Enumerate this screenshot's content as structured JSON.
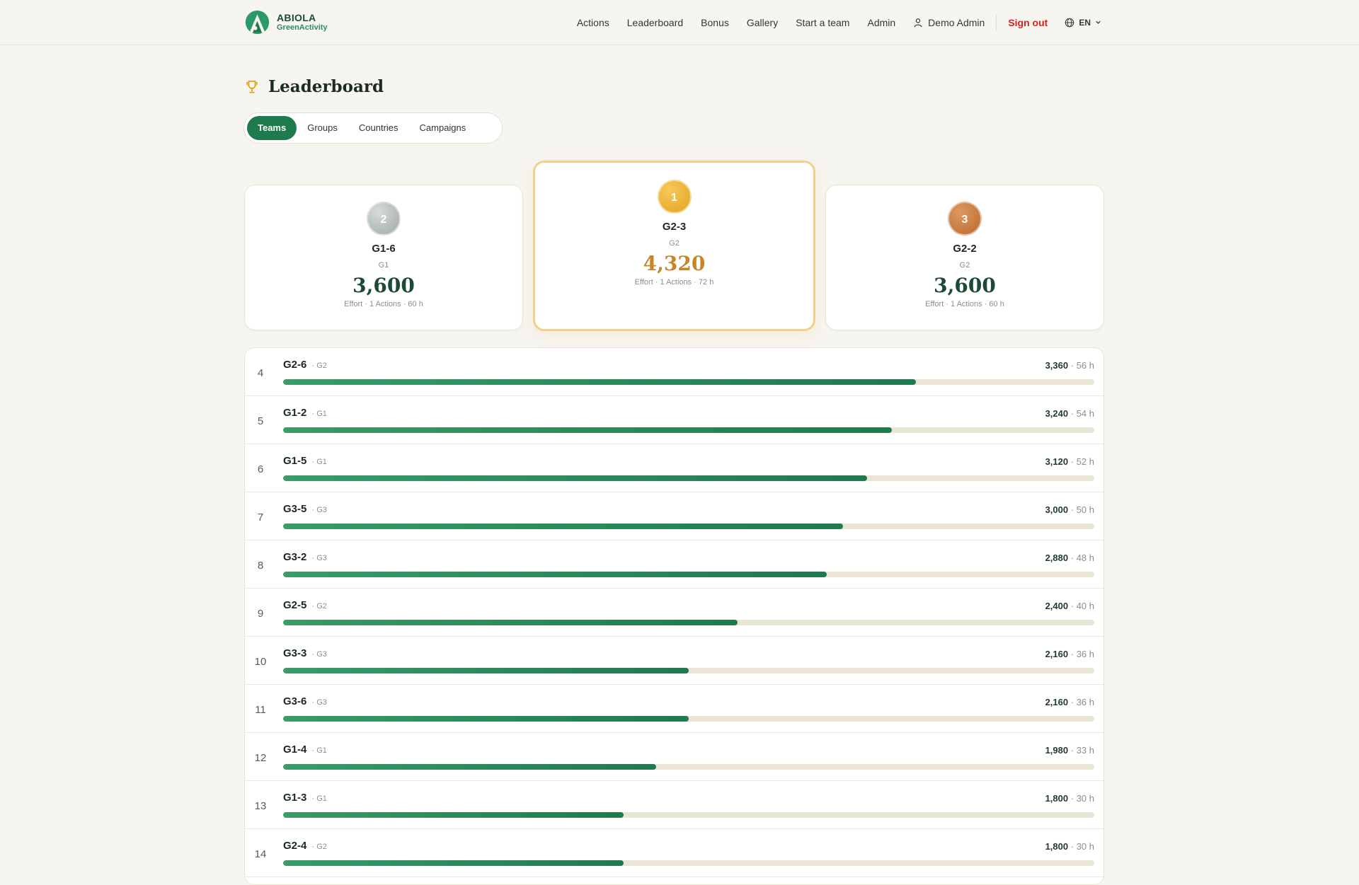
{
  "brand": {
    "name": "ABIOLA",
    "sub": "GreenActivity"
  },
  "nav": {
    "items": [
      "Actions",
      "Leaderboard",
      "Bonus",
      "Gallery",
      "Start a team",
      "Admin"
    ],
    "user": "Demo Admin",
    "signout": "Sign out",
    "lang": "EN"
  },
  "colors": {
    "accent": "#1f7a4d",
    "gold": "#e3a321",
    "silver": "#a7aeae",
    "bronze": "#c07438",
    "signout": "#d62020"
  },
  "page": {
    "title": "Leaderboard"
  },
  "tabs": [
    {
      "label": "Teams",
      "active": true
    },
    {
      "label": "Groups",
      "active": false
    },
    {
      "label": "Countries",
      "active": false
    },
    {
      "label": "Campaigns",
      "active": false
    }
  ],
  "podium": {
    "first": {
      "rank": "1",
      "name": "G2-3",
      "group": "G2",
      "score": "4,320",
      "meta": "Effort · 1 Actions · 72 h"
    },
    "second": {
      "rank": "2",
      "name": "G1-6",
      "group": "G1",
      "score": "3,600",
      "meta": "Effort · 1 Actions · 60 h"
    },
    "third": {
      "rank": "3",
      "name": "G2-2",
      "group": "G2",
      "score": "3,600",
      "meta": "Effort · 1 Actions · 60 h"
    }
  },
  "rows": [
    {
      "rank": "4",
      "name": "G2-6",
      "group": "· G2",
      "score": "3,360",
      "hours": "· 56 h",
      "progress": 0.78
    },
    {
      "rank": "5",
      "name": "G1-2",
      "group": "· G1",
      "score": "3,240",
      "hours": "· 54 h",
      "progress": 0.75
    },
    {
      "rank": "6",
      "name": "G1-5",
      "group": "· G1",
      "score": "3,120",
      "hours": "· 52 h",
      "progress": 0.72
    },
    {
      "rank": "7",
      "name": "G3-5",
      "group": "· G3",
      "score": "3,000",
      "hours": "· 50 h",
      "progress": 0.69
    },
    {
      "rank": "8",
      "name": "G3-2",
      "group": "· G3",
      "score": "2,880",
      "hours": "· 48 h",
      "progress": 0.67
    },
    {
      "rank": "9",
      "name": "G2-5",
      "group": "· G2",
      "score": "2,400",
      "hours": "· 40 h",
      "progress": 0.56
    },
    {
      "rank": "10",
      "name": "G3-3",
      "group": "· G3",
      "score": "2,160",
      "hours": "· 36 h",
      "progress": 0.5
    },
    {
      "rank": "11",
      "name": "G3-6",
      "group": "· G3",
      "score": "2,160",
      "hours": "· 36 h",
      "progress": 0.5
    },
    {
      "rank": "12",
      "name": "G1-4",
      "group": "· G1",
      "score": "1,980",
      "hours": "· 33 h",
      "progress": 0.46
    },
    {
      "rank": "13",
      "name": "G1-3",
      "group": "· G1",
      "score": "1,800",
      "hours": "· 30 h",
      "progress": 0.42
    },
    {
      "rank": "14",
      "name": "G2-4",
      "group": "· G2",
      "score": "1,800",
      "hours": "· 30 h",
      "progress": 0.42
    }
  ]
}
